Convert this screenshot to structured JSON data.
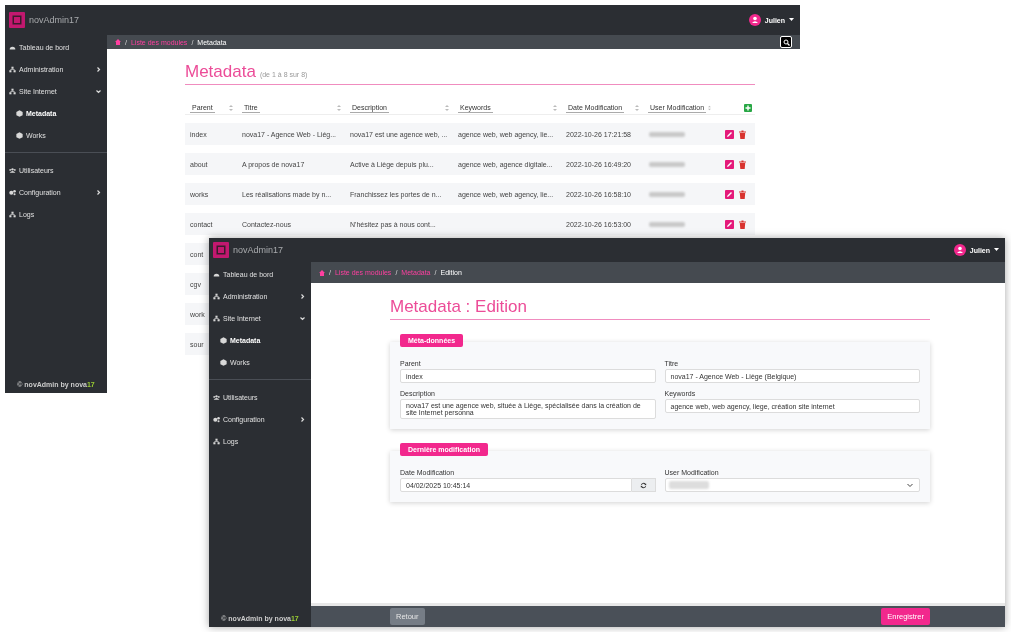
{
  "screens": [
    {
      "kind": "list",
      "app_name": "novAdmin17",
      "user": "Julien",
      "sidebar": {
        "sections": [
          [
            {
              "label": "Tableau de bord",
              "selected": false
            },
            {
              "label": "Administration",
              "selected": false,
              "expanded": false
            },
            {
              "label": "Site Internet",
              "selected": false,
              "expanded": true,
              "children": [
                {
                  "label": "Metadata",
                  "selected": true
                },
                {
                  "label": "Works",
                  "selected": false
                }
              ]
            }
          ],
          [
            {
              "label": "Utilisateurs",
              "selected": false
            },
            {
              "label": "Configuration",
              "selected": false,
              "expanded": false
            },
            {
              "label": "Logs",
              "selected": false
            }
          ]
        ]
      },
      "footer": {
        "text": "© novAdmin by nova",
        "accent": "17"
      },
      "breadcrumb": {
        "separator": "/",
        "items": [
          {
            "label": "Liste des modules",
            "current": false
          },
          {
            "label": "Metadata",
            "current": true
          }
        ]
      },
      "title": "Metadata",
      "subtitle": "(de 1 à 8 sur 8)",
      "table": {
        "columns": [
          "Parent",
          "Titre",
          "Description",
          "Keywords",
          "Date Modification",
          "User Modification"
        ],
        "rows": [
          {
            "parent": "index",
            "titre": "nova17 - Agence Web - Liég...",
            "description": "nova17 est une agence web, ...",
            "keywords": "agence web, web agency, lie...",
            "date": "2022-10-26 17:21:58"
          },
          {
            "parent": "about",
            "titre": "A propos de nova17",
            "description": "Active à Liège depuis plu...",
            "keywords": "agence web, agence digitale...",
            "date": "2022-10-26 16:49:20"
          },
          {
            "parent": "works",
            "titre": "Les réalisations made by n...",
            "description": "Franchissez les portes de n...",
            "keywords": "agence web, web agency, lie...",
            "date": "2022-10-26 16:58:10"
          },
          {
            "parent": "contact",
            "titre": "Contactez-nous",
            "description": "N'hésitez pas à nous cont...",
            "date": "2022-10-26 16:53:00"
          },
          {
            "parent": "cont"
          },
          {
            "parent": "cgv"
          },
          {
            "parent": "work"
          },
          {
            "parent": "sour"
          }
        ]
      }
    },
    {
      "kind": "edit",
      "app_name": "novAdmin17",
      "user": "Julien",
      "sidebar": {
        "sections": [
          [
            {
              "label": "Tableau de bord",
              "selected": false
            },
            {
              "label": "Administration",
              "selected": false,
              "expanded": false
            },
            {
              "label": "Site Internet",
              "selected": false,
              "expanded": true,
              "children": [
                {
                  "label": "Metadata",
                  "selected": true
                },
                {
                  "label": "Works",
                  "selected": false
                }
              ]
            }
          ],
          [
            {
              "label": "Utilisateurs",
              "selected": false
            },
            {
              "label": "Configuration",
              "selected": false,
              "expanded": false
            },
            {
              "label": "Logs",
              "selected": false
            }
          ]
        ]
      },
      "footer": {
        "text": "© novAdmin by nova",
        "accent": "17"
      },
      "breadcrumb": {
        "separator": "/",
        "items": [
          {
            "label": "Liste des modules",
            "current": false
          },
          {
            "label": "Metadata",
            "current": false
          },
          {
            "label": "Edition",
            "current": true
          }
        ]
      },
      "title": "Metadata : Edition",
      "cards": [
        {
          "badge": "Méta-données",
          "fields": [
            {
              "kind": "text",
              "label": "Parent",
              "value": "index"
            },
            {
              "kind": "text",
              "label": "Titre",
              "value": "nova17 - Agence Web - Liège (Belgique)"
            },
            {
              "kind": "text",
              "label": "Description",
              "value": "nova17 est une agence web, située à Liège, spécialisée dans la création de site Internet personna"
            },
            {
              "kind": "text",
              "label": "Keywords",
              "value": "agence web, web agency, liege, création site internet"
            }
          ]
        },
        {
          "badge": "Dernière modification",
          "fields": [
            {
              "kind": "date",
              "label": "Date Modification",
              "value": "04/02/2025 10:45:14"
            },
            {
              "kind": "select",
              "label": "User Modification"
            }
          ]
        }
      ],
      "buttons": [
        {
          "label": "Retour",
          "kind": "secondary"
        },
        {
          "label": "Enregistrer",
          "kind": "primary"
        }
      ]
    }
  ]
}
